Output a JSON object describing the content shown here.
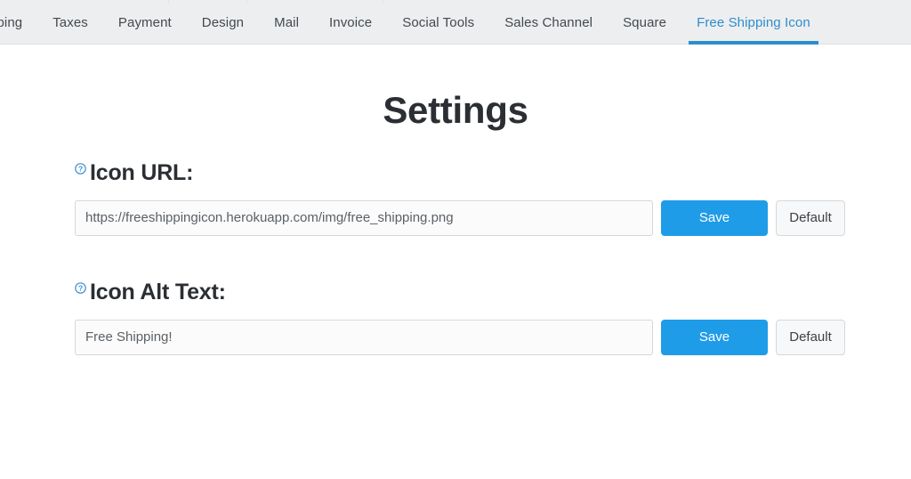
{
  "nav": {
    "items": [
      {
        "label": "pping",
        "active": false,
        "truncated": true
      },
      {
        "label": "Taxes",
        "active": false
      },
      {
        "label": "Payment",
        "active": false
      },
      {
        "label": "Design",
        "active": false
      },
      {
        "label": "Mail",
        "active": false
      },
      {
        "label": "Invoice",
        "active": false
      },
      {
        "label": "Social Tools",
        "active": false
      },
      {
        "label": "Sales Channel",
        "active": false
      },
      {
        "label": "Square",
        "active": false
      },
      {
        "label": "Free Shipping Icon",
        "active": true
      }
    ],
    "active_color": "#2c8ecb",
    "background": "#edeef0"
  },
  "main": {
    "title": "Settings",
    "fields": [
      {
        "key": "icon_url",
        "label": "Icon URL:",
        "help_icon": "help-circle-icon",
        "value": "https://freeshippingicon.herokuapp.com/img/free_shipping.png",
        "placeholder": "",
        "save_label": "Save",
        "default_label": "Default"
      },
      {
        "key": "icon_alt_text",
        "label": "Icon Alt Text:",
        "help_icon": "help-circle-icon",
        "value": "Free Shipping!",
        "placeholder": "",
        "save_label": "Save",
        "default_label": "Default"
      }
    ]
  },
  "colors": {
    "accent": "#1f9ce8",
    "link": "#2c8ecb",
    "nav_bg": "#edeef0",
    "text": "#2b2f33"
  }
}
